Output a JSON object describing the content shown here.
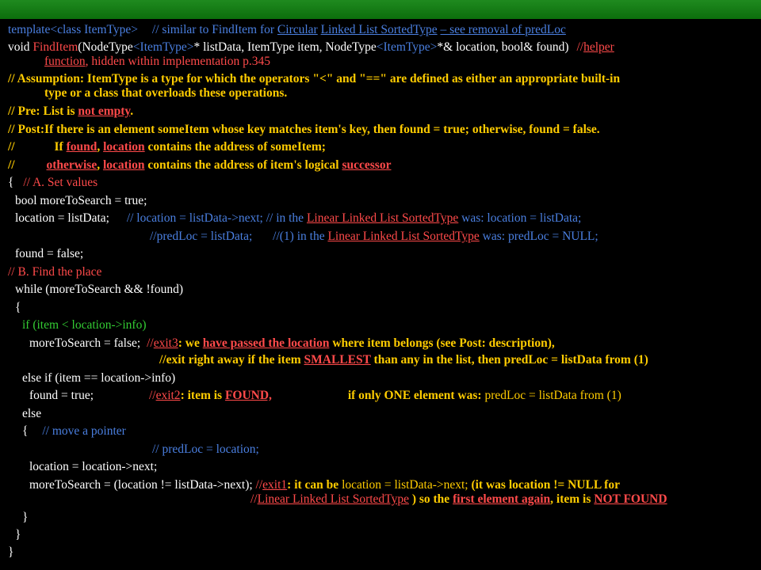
{
  "colors": {
    "background": "#000000",
    "title_bar": "#1a8a1a",
    "code_text": "#ffffff",
    "comment_blue": "#4a7fe0",
    "assertion_yellow": "#ffcc00",
    "highlight_red": "#ff4a4a",
    "section_green": "#33cc33"
  },
  "code": {
    "l1": {
      "template": "template",
      "type_param": "<class ItemType>",
      "c1": "// similar to FindItem for",
      "circular": "Circular",
      "linked": "Linked List SortedType",
      "see": "– see removal of predLoc"
    },
    "l2": {
      "void": "void",
      "fname": "FindItem",
      "p1": "(NodeType",
      "t1": "<ItemType>",
      "p2": "* listData, ItemType item, NodeType",
      "t2": "<ItemType>",
      "p3": "*& location, bool& found)",
      "slash": "//",
      "helper": "helper",
      "function": "function",
      "hidden": ", hidden within implementation p.345"
    },
    "l3": {
      "assump_a": "// Assumption: ItemType is a type for which the operators \"<\" and \"==\" are defined as either an appropriate built-in",
      "assump_b": "type or a class that overloads these operations."
    },
    "l4": {
      "pre": "// Pre: List is ",
      "notempty": "not empty",
      "dot": "."
    },
    "l5": {
      "post": "// Post:If there is an element someItem whose key matches item's key, then found = true; otherwise, found = false."
    },
    "l6": {
      "slash": "//",
      "if": "If ",
      "found": "found",
      "comma": ", ",
      "location": "location",
      "rest": " contains the address of someItem;"
    },
    "l7": {
      "slash": "//",
      "otherwise": "otherwise",
      "comma": ", ",
      "location": "location",
      "rest": " contains the address of item's logical ",
      "successor": "successor"
    },
    "l8": {
      "brace": "{",
      "comment": "// A. Set values"
    },
    "l9": {
      "code": "bool moreToSearch = true;"
    },
    "l10": {
      "code": "location = listData;",
      "c1": "// location = listData->next; // in the ",
      "lls": "Linear Linked List SortedType",
      "c2": " was: location = listData;"
    },
    "l11": {
      "c1": "//predLoc = listData;",
      "c2": "//(1) in the ",
      "lls": "Linear Linked List SortedType",
      "c3": " was: predLoc = NULL;"
    },
    "l12": {
      "code": "found = false;"
    },
    "l13": {
      "comment": "// B. Find the place"
    },
    "l14": {
      "code": "while (moreToSearch && !found)"
    },
    "l15": {
      "code": "{"
    },
    "l16": {
      "code": "if (item < location->info)"
    },
    "l17": {
      "code": "moreToSearch = false;",
      "slash": "//",
      "exit3": "exit3",
      "t1": ": we ",
      "passed": "have passed the location",
      "t2": " where item belongs (see Post: description),"
    },
    "l18": {
      "t1": "//exit right away if the item ",
      "smallest": "SMALLEST",
      "t2": " than any in the list, then predLoc = listData from (1)"
    },
    "l19": {
      "code": "else if (item == location->info)"
    },
    "l20": {
      "code": "found = true;",
      "slash": "//",
      "exit2": "exit2",
      "t1": ": item is ",
      "foundcap": "FOUND,",
      "t2": "if only ONE element was: ",
      "t3": "predLoc = listData from (1)"
    },
    "l21": {
      "code": "else"
    },
    "l22": {
      "brace": "{",
      "comment": "// move a pointer"
    },
    "l23": {
      "comment": "// predLoc = location;"
    },
    "l24": {
      "code": "location = location->next;"
    },
    "l25": {
      "code": "moreToSearch = (location != listData->next);",
      "slash": "//",
      "exit1": "exit1",
      "t1": ": it can be ",
      "loc": "location = listData->next;",
      "t2": " (it was  location != NULL for"
    },
    "l26": {
      "slash": "//",
      "lls": "Linear Linked List SortedType",
      "t1": " ) so the ",
      "first": "first element again",
      "t2": ", item is ",
      "notfound": "NOT FOUND"
    },
    "l27": {
      "code": "}"
    },
    "l28": {
      "code": "}"
    },
    "l29": {
      "code": "}"
    }
  }
}
